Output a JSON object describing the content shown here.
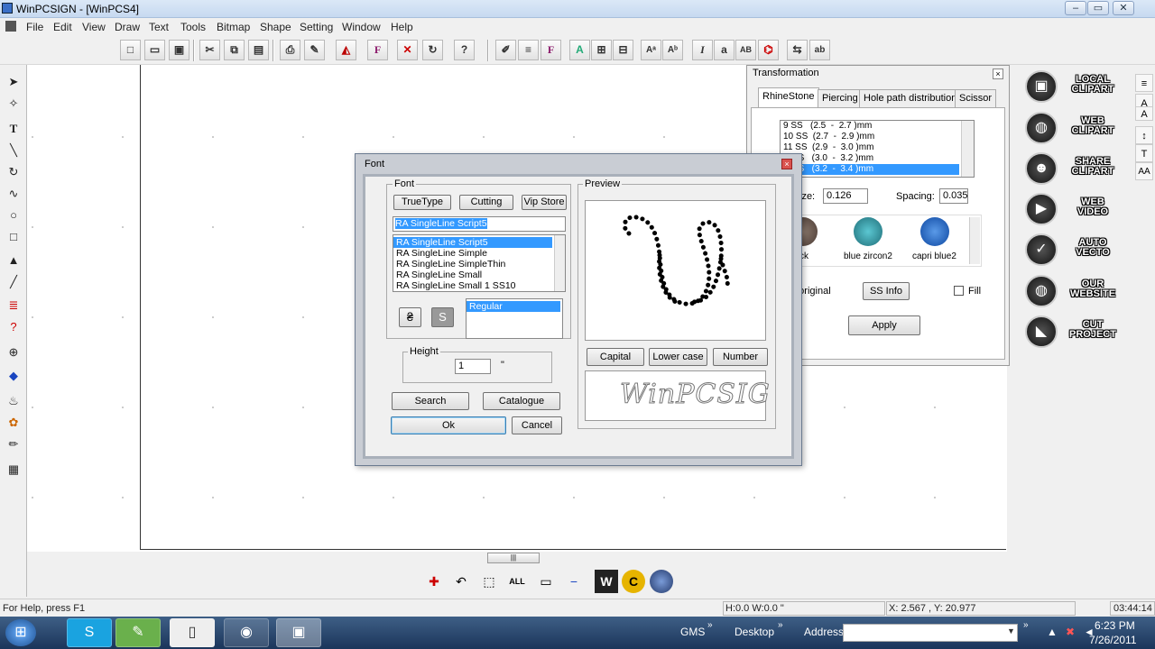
{
  "window": {
    "title": "WinPCSIGN - [WinPCS4]"
  },
  "menu": [
    "File",
    "Edit",
    "View",
    "Draw",
    "Text",
    "Tools",
    "Bitmap",
    "Shape",
    "Setting",
    "Window",
    "Help"
  ],
  "transformation": {
    "title": "Transformation",
    "tabs": [
      "RhineStone",
      "Piercing",
      "Hole path  distribution",
      "Scissor"
    ],
    "ss_list": [
      "9 SS   (2.5  -  2.7 )mm",
      "10 SS  (2.7  -  2.9 )mm",
      "11 SS  (2.9  -  3.0 )mm",
      "      S   (3.0  -  3.2 )mm",
      "      S   (3.2  -  3.4 )mm"
    ],
    "size_label": "ize:",
    "size_value": "0.126",
    "spacing_label": "Spacing:",
    "spacing_value": "0.035",
    "stones": [
      {
        "name": "ck",
        "color": "#5a4a44"
      },
      {
        "name": "blue zircon2",
        "color": "#1f7c88"
      },
      {
        "name": "capri blue2",
        "color": "#1565c0"
      }
    ],
    "original_label": "e original",
    "ss_info_button": "SS Info",
    "fill_label": "Fill",
    "apply_button": "Apply"
  },
  "side_buttons": [
    {
      "line1": "LOCAL",
      "line2": "CLIPART"
    },
    {
      "line1": "WEB",
      "line2": "CLIPART"
    },
    {
      "line1": "SHARE",
      "line2": "CLIPART"
    },
    {
      "line1": "WEB",
      "line2": "VIDEO"
    },
    {
      "line1": "AUTO",
      "line2": "VECTO"
    },
    {
      "line1": "OUR",
      "line2": "WEBSITE"
    },
    {
      "line1": "CUT",
      "line2": "PROJECT"
    }
  ],
  "font_dialog": {
    "title": "Font",
    "font_group": "Font",
    "truetype_button": "TrueType",
    "cutting_button": "Cutting",
    "vipstore_button": "Vip Store",
    "font_field": "RA SingleLine Script5",
    "font_list": [
      "RA SingleLine Script5",
      "RA SingleLine Simple",
      "RA SingleLine SimpleThin",
      "RA SingleLine Small",
      "RA SingleLine Small 1 SS10"
    ],
    "style_list": [
      "Regular"
    ],
    "height_group": "Height",
    "height_value": "1",
    "height_unit": "\"",
    "search_button": "Search",
    "catalogue_button": "Catalogue",
    "ok_button": "Ok",
    "cancel_button": "Cancel",
    "preview_group": "Preview",
    "preview_letter": "W",
    "capital_button": "Capital",
    "lowercase_button": "Lower case",
    "number_button": "Number",
    "sample_text": "WinPCSIG"
  },
  "status": {
    "help": "For Help, press F1",
    "hw": "H:0.0  W:0.0 \"",
    "coords": "X: 2.567 , Y: 20.977",
    "clock": "03:44:14"
  },
  "taskbar": {
    "gms": "GMS",
    "desktop": "Desktop",
    "address": "Address",
    "time": "6:23 PM",
    "date": "7/26/2011"
  }
}
